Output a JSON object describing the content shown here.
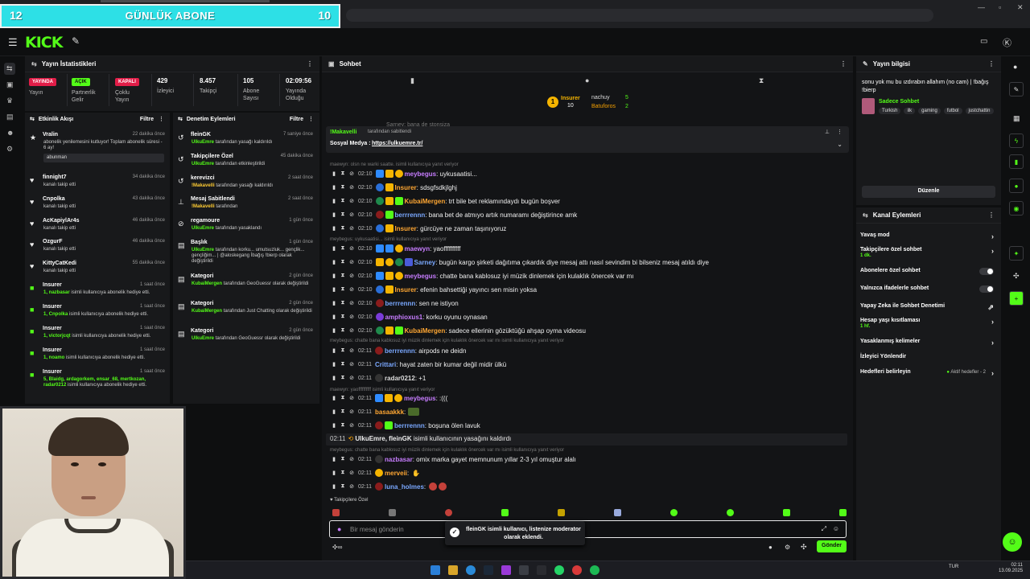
{
  "banner": {
    "left_num": "12",
    "title": "GÜNLÜK ABONE",
    "right_num": "10"
  },
  "header": {
    "logo": "KICK"
  },
  "stats": {
    "title": "Yayın İstatistikleri",
    "items": [
      {
        "pill": "YAYINDA",
        "label": "Yayın"
      },
      {
        "pill": "AÇIK",
        "label": "Partnerlik Gelir"
      },
      {
        "pill": "KAPALI",
        "label": "Çoklu Yayın"
      },
      {
        "value": "429",
        "label": "İzleyici"
      },
      {
        "value": "8.457",
        "label": "Takipçi"
      },
      {
        "value": "105",
        "label": "Abone Sayısı"
      },
      {
        "value": "02:09:56",
        "label": "Yayında Olduğu"
      }
    ]
  },
  "events": {
    "title": "Etkinlik Akışı",
    "filter": "Filtre",
    "items": [
      {
        "name": "Vralin",
        "time": "22 dakika önce",
        "desc": "abonelik yenilemesini kutluyor! Toplam abonelik süresi - 6 ay!",
        "box": "abunman"
      },
      {
        "name": "finnight7",
        "time": "34 dakika önce",
        "desc": "kanalı takip etti"
      },
      {
        "name": "Cnpolka",
        "time": "43 dakika önce",
        "desc": "kanalı takip etti"
      },
      {
        "name": "AcKapiylAr4s",
        "time": "46 dakika önce",
        "desc": "kanalı takip etti"
      },
      {
        "name": "OzgurF",
        "time": "46 dakika önce",
        "desc": "kanalı takip etti"
      },
      {
        "name": "KittyCatKedi",
        "time": "55 dakika önce",
        "desc": "kanalı takip etti"
      },
      {
        "name": "Insurer",
        "time": "1 saat önce",
        "hl": "1, nazbasar",
        "desc": "isimli kullanıcıya abonelik hediye etti."
      },
      {
        "name": "Insurer",
        "time": "1 saat önce",
        "hl": "1, Cnpolka",
        "desc": "isimli kullanıcıya abonelik hediye etti."
      },
      {
        "name": "Insurer",
        "time": "1 saat önce",
        "hl": "1, victorjcqt",
        "desc": "isimli kullanıcıya abonelik hediye etti."
      },
      {
        "name": "Insurer",
        "time": "1 saat önce",
        "hl": "1, noamo",
        "desc": "isimli kullanıcıya abonelik hediye etti."
      },
      {
        "name": "Insurer",
        "time": "1 saat önce",
        "hl": "5, Blaidg, ardagorkem, ensar_68, mertkozan, radar0212",
        "desc": "isimli kullanıcıya abonelik hediye etti."
      }
    ]
  },
  "mods": {
    "title": "Denetim Eylemleri",
    "filter": "Filtre",
    "items": [
      {
        "name": "fleinGK",
        "time": "7 saniye önce",
        "user": "UlkuEmre",
        "desc": "tarafından yasağı kaldırıldı"
      },
      {
        "name": "Takipçilere Özel",
        "time": "45 dakika önce",
        "user": "UlkuEmre",
        "desc": "tarafından etkinleştirildi"
      },
      {
        "name": "kerevizci",
        "time": "2 saat önce",
        "user": "!Makavelli",
        "desc": "tarafından yasağı kaldırıldı"
      },
      {
        "name": "Mesaj Sabitlendi",
        "time": "2 saat önce",
        "user": "!Makavelli",
        "desc": "tarafından"
      },
      {
        "name": "regamoure",
        "time": "1 gün önce",
        "user": "UlkuEmre",
        "desc": "tarafından yasaklandı"
      },
      {
        "name": "Başlık",
        "time": "1 gün önce",
        "user": "UlkuEmre",
        "desc": "tarafından korku... umutsuzluk... gençlik... gençliğim... | @aloskegang İbağış !bierp olarak değiştirildi"
      },
      {
        "name": "Kategori",
        "time": "2 gün önce",
        "user": "KubaiMergen",
        "desc": "tarafından GeoGuessr olarak değiştirildi"
      },
      {
        "name": "Kategori",
        "time": "2 gün önce",
        "user": "KubaiMergen",
        "desc": "tarafından Just Chatting olarak değiştirildi"
      },
      {
        "name": "Kategori",
        "time": "2 gün önce",
        "user": "UlkuEmre",
        "desc": "tarafından GeoGuessr olarak değiştirildi"
      }
    ]
  },
  "chat": {
    "title": "Sohbet",
    "top_subs": [
      {
        "name": "Insurer",
        "count": "10"
      },
      {
        "name": "nachuy",
        "count": "5"
      },
      {
        "name": "Batuforos",
        "count": "2"
      }
    ],
    "pinned": {
      "by": "!Makavelli",
      "by_suffix": "tarafından sabitlendi",
      "label": "Sosyal Medya :",
      "link": "https://ulkuemre.tr/"
    },
    "peek": "Sarney: bana de stonsiza",
    "replies": [
      "maewyn: olsn ne warki saatte. isimli kullanıcıya yanıt veriyor",
      "meybegus: uykusaatisi... isimli kullanıcıya yanıt veriyor",
      "meybegus: chatte bana kablosuz iyi müzik dinlemek için kulaklık önercek var mı isimli kullanıcıya yanıt veriyor",
      "maewyn: yaoffffffffff isimli kullanıcıya yanıt veriyor",
      "meybegus: chatte bana kablosuz iyi müzik dinlemek için kulaklık önercek var mı isimli kullanıcıya yanıt veriyor"
    ],
    "messages": [
      {
        "time": "02:10",
        "user": "meybegus",
        "text": ": uykusaatisi..."
      },
      {
        "time": "02:10",
        "user": "Insurer",
        "text": ": sdsgfsdkjlghj"
      },
      {
        "time": "02:10",
        "user": "KubaiMergen",
        "text": ": trt bile bet reklamındaydı bugün boşver"
      },
      {
        "time": "02:10",
        "user": "berrrennn",
        "text": ": bana bet de atmıyo artık numaramı değiştirince amk"
      },
      {
        "time": "02:10",
        "user": "Insurer",
        "text": ": gürcüye ne zaman taşınıyoruz"
      },
      {
        "time": "02:10",
        "user": "maewyn",
        "text": ": yaoffffffffff"
      },
      {
        "time": "02:10",
        "user": "Sarney",
        "text": ": bugün kargo şirketi dağıtıma çıkardık diye mesaj attı nasıl sevindim bi bilseniz mesaj atıldı diye"
      },
      {
        "time": "02:10",
        "user": "meybegus",
        "text": ": chatte bana kablosuz iyi müzik dinlemek için kulaklık önercek var mı"
      },
      {
        "time": "02:10",
        "user": "Insurer",
        "text": ": efenin bahsettiği yayıncı sen misin yoksa"
      },
      {
        "time": "02:10",
        "user": "berrrennn",
        "text": ": sen ne istiyon"
      },
      {
        "time": "02:10",
        "user": "amphioxus1",
        "text": ": korku oyunu oynasan"
      },
      {
        "time": "02:10",
        "user": "KubaiMergen",
        "text": ": sadece ellerinin gözüktüğü ahşap oyma videosu"
      },
      {
        "time": "02:11",
        "user": "berrrennn",
        "text": ": airpods ne deidn"
      },
      {
        "time": "02:11",
        "user": "Crittari",
        "text": ": hayat zaten bir kumar değil midir ülkü"
      },
      {
        "time": "02:11",
        "user": "radar0212",
        "text": ": +1"
      },
      {
        "time": "02:11",
        "user": "meybegus",
        "text": ": :((("
      },
      {
        "time": "02:11",
        "user": "basaakkk",
        "text": ":"
      },
      {
        "time": "02:11",
        "user": "berrrennn",
        "text": ": boşuna ölen lavuk"
      },
      {
        "time": "02:11",
        "user": "nazbasar",
        "text": ": omix marka gayet memnunum yıllar 2-3 yıl omuştur alalı"
      },
      {
        "time": "02:11",
        "user": "merveii",
        "text": ":"
      },
      {
        "time": "02:11",
        "user": "luna_holmes",
        "text": ":"
      }
    ],
    "system": {
      "time": "02:11",
      "users": "UlkuEmre, fleinGK",
      "text": "isimli kullanıcının yasağını kaldırdı"
    },
    "followers_only": "Takipçilere Özel",
    "input_placeholder": "Bir mesaj gönderin",
    "send": "Gönder",
    "toast": "fleinGK isimli kullanıcı, listenize moderator olarak eklendi."
  },
  "info": {
    "title": "Yayın bilgisi",
    "stream_title": "sonu yok mu bu ızdırabın allahım (no cam) | !bağış !bierp",
    "mode": "Sadece Sohbet",
    "tags": [
      "Turkish",
      "ilk",
      "gaming",
      "futbol",
      "justchattin"
    ],
    "edit": "Düzenle"
  },
  "actions": {
    "title": "Kanal Eylemleri",
    "items": [
      {
        "label": "Yavaş mod",
        "kind": "arrow"
      },
      {
        "label": "Takipçilere özel sohbet",
        "sub": "1 dk.",
        "kind": "arrow"
      },
      {
        "label": "Abonelere özel sohbet",
        "kind": "toggle"
      },
      {
        "label": "Yalnızca ifadelerle sohbet",
        "kind": "toggle"
      },
      {
        "label": "Yapay Zeka ile Sohbet Denetimi",
        "kind": "ext"
      },
      {
        "label": "Hesap yaşı kısıtlaması",
        "sub": "1 hf.",
        "kind": "arrow"
      },
      {
        "label": "Yasaklanmış kelimeler",
        "kind": "arrow"
      },
      {
        "label": "İzleyici Yönlendir",
        "kind": "none"
      },
      {
        "label": "Hedefleri belirleyin",
        "extra": "Aktif hedefler - 2",
        "kind": "arrow"
      }
    ]
  },
  "taskbar": {
    "lang": "TUR",
    "clock": "02:11",
    "date": "13.09.2025"
  },
  "colors": {
    "accent": "#53fc18",
    "banner": "#2de0e6",
    "panel": "#18191b"
  }
}
